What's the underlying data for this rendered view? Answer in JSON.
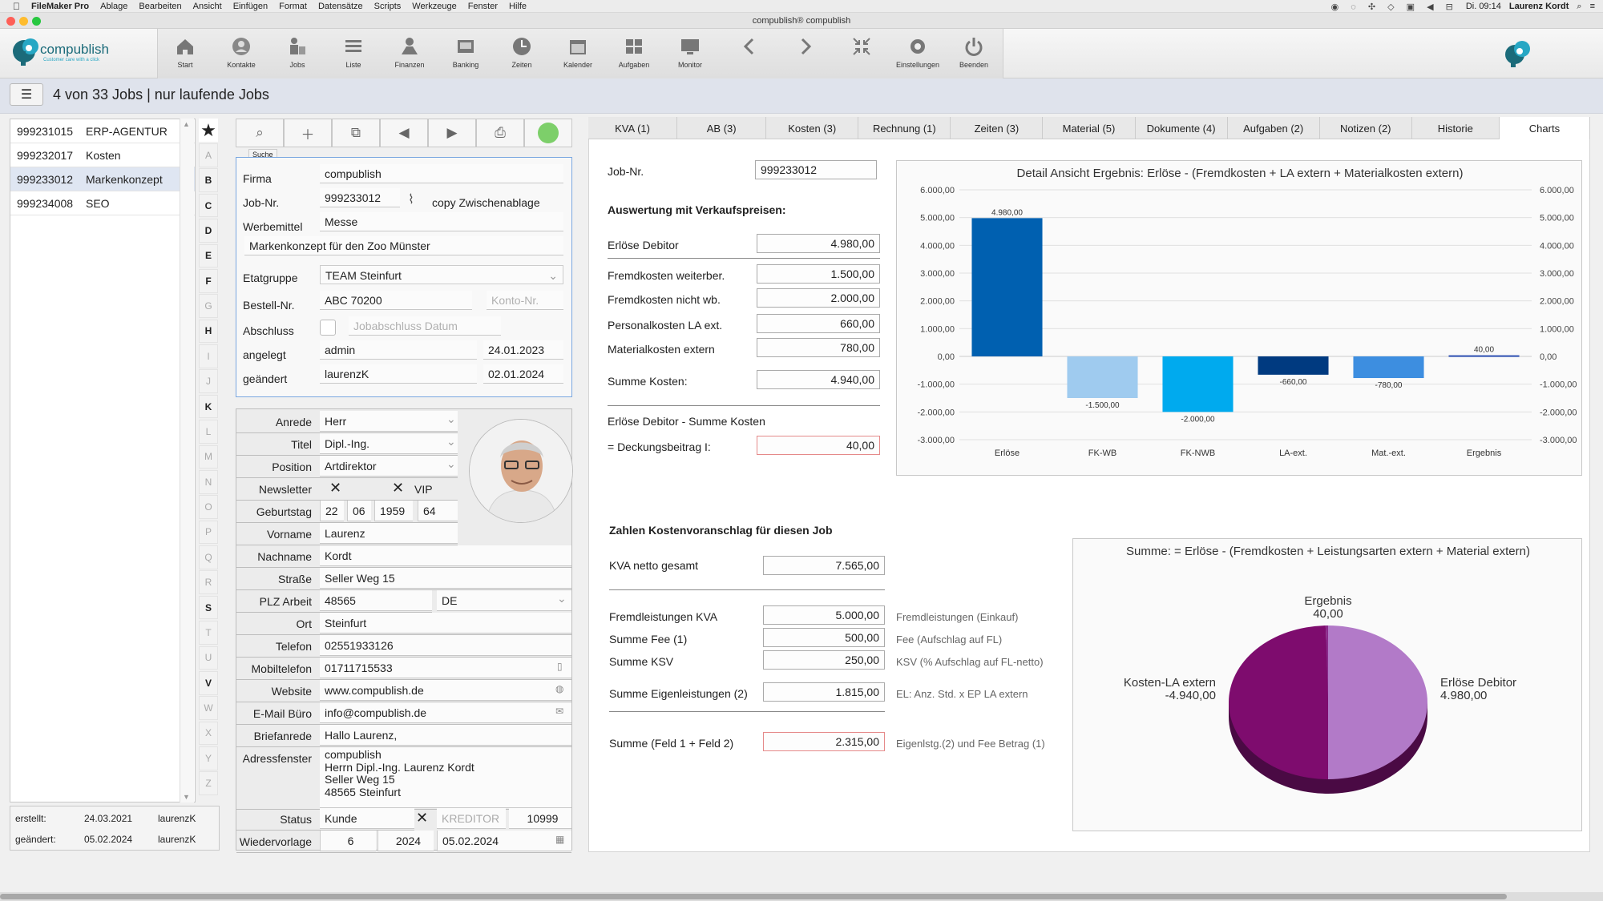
{
  "menubar": {
    "app": "FileMaker Pro",
    "items": [
      "Ablage",
      "Bearbeiten",
      "Ansicht",
      "Einfügen",
      "Format",
      "Datensätze",
      "Scripts",
      "Werkzeuge",
      "Fenster",
      "Hilfe"
    ],
    "clock": "Di. 09:14",
    "user": "Laurenz Kordt"
  },
  "window": {
    "title": "compublish® compublish"
  },
  "logo": {
    "name": "compublish",
    "tagline": "Customer care with a click"
  },
  "toolbar": {
    "buttons": [
      {
        "label": "Start",
        "icon": "home-icon"
      },
      {
        "label": "Kontakte",
        "icon": "contacts-icon"
      },
      {
        "label": "Jobs",
        "icon": "jobs-icon"
      },
      {
        "label": "Liste",
        "icon": "list-icon"
      },
      {
        "label": "Finanzen",
        "icon": "finance-icon"
      },
      {
        "label": "Banking",
        "icon": "banking-icon"
      },
      {
        "label": "Zeiten",
        "icon": "clock-icon"
      },
      {
        "label": "Kalender",
        "icon": "calendar-icon"
      },
      {
        "label": "Aufgaben",
        "icon": "tasks-icon"
      },
      {
        "label": "Monitor",
        "icon": "monitor-icon"
      },
      {
        "label": "",
        "icon": "back-icon"
      },
      {
        "label": "",
        "icon": "forward-icon"
      },
      {
        "label": "",
        "icon": "collapse-icon"
      },
      {
        "label": "Einstellungen",
        "icon": "gear-icon"
      },
      {
        "label": "Beenden",
        "icon": "power-icon"
      }
    ]
  },
  "header": {
    "title": "4 von 33 Jobs | nur laufende Jobs"
  },
  "joblist": {
    "items": [
      {
        "num": "999231015",
        "name": "ERP-AGENTUR"
      },
      {
        "num": "999232017",
        "name": "Kosten"
      },
      {
        "num": "999233012",
        "name": "Markenkonzept"
      },
      {
        "num": "999234008",
        "name": "SEO"
      }
    ],
    "footer": {
      "created_label": "erstellt:",
      "created_date": "24.03.2021",
      "created_user": "laurenzK",
      "changed_label": "geändert:",
      "changed_date": "05.02.2024",
      "changed_user": "laurenzK"
    }
  },
  "alphabet": [
    "A",
    "B",
    "C",
    "D",
    "E",
    "F",
    "G",
    "H",
    "I",
    "J",
    "K",
    "L",
    "M",
    "N",
    "O",
    "P",
    "Q",
    "R",
    "S",
    "T",
    "U",
    "V",
    "W",
    "X",
    "Y",
    "Z"
  ],
  "alphabet_active": [
    "B",
    "C",
    "D",
    "E",
    "F",
    "H",
    "K",
    "S",
    "V"
  ],
  "record_toolbar": {
    "tooltip": "Suche"
  },
  "job": {
    "firma_label": "Firma",
    "firma": "compublish",
    "jobnr_label": "Job-Nr.",
    "jobnr": "999233012",
    "copy": "copy Zwischenablage",
    "werbemittel_label": "Werbemittel",
    "werbemittel": "Messe",
    "beschreibung": "Markenkonzept für den Zoo Münster",
    "etatgruppe_label": "Etatgruppe",
    "etatgruppe": "TEAM Steinfurt",
    "bestellnr_label": "Bestell-Nr.",
    "bestellnr": "ABC 70200",
    "kontonr_ph": "Konto-Nr.",
    "abschluss_label": "Abschluss",
    "abschluss_ph": "Jobabschluss Datum",
    "angelegt_label": "angelegt",
    "angelegt_user": "admin",
    "angelegt_date": "24.01.2023",
    "geaendert_label": "geändert",
    "geaendert_user": "laurenzK",
    "geaendert_date": "02.01.2024"
  },
  "contact": {
    "anrede_label": "Anrede",
    "anrede": "Herr",
    "titel_label": "Titel",
    "titel": "Dipl.-Ing.",
    "position_label": "Position",
    "position": "Artdirektor",
    "newsletter_label": "Newsletter",
    "vip_label": "VIP",
    "geburtstag_label": "Geburtstag",
    "geb_tag": "22",
    "geb_monat": "06",
    "geb_jahr": "1959",
    "alter": "64",
    "vorname_label": "Vorname",
    "vorname": "Laurenz",
    "nachname_label": "Nachname",
    "nachname": "Kordt",
    "strasse_label": "Straße",
    "strasse": "Seller Weg 15",
    "plz_label": "PLZ Arbeit",
    "plz": "48565",
    "land": "DE",
    "ort_label": "Ort",
    "ort": "Steinfurt",
    "telefon_label": "Telefon",
    "telefon": "02551933126",
    "mobil_label": "Mobiltelefon",
    "mobil": "01711715533",
    "website_label": "Website",
    "website": "www.compublish.de",
    "email_label": "E-Mail Büro",
    "email": "info@compublish.de",
    "briefanrede_label": "Briefanrede",
    "briefanrede": "Hallo Laurenz,",
    "adressfenster_label": "Adressfenster",
    "adresse": [
      "compublish",
      "Herrn Dipl.-Ing. Laurenz  Kordt",
      "Seller Weg 15",
      "48565 Steinfurt"
    ],
    "status_label": "Status",
    "status": "Kunde",
    "kreditor": "KREDITOR",
    "kreditor_nr": "10999",
    "wiedervorlage_label": "Wiedervorlage",
    "wv_1": "6",
    "wv_2": "2024",
    "wv_date": "05.02.2024"
  },
  "tabs": [
    "KVA (1)",
    "AB (3)",
    "Kosten (3)",
    "Rechnung (1)",
    "Zeiten (3)",
    "Material (5)",
    "Dokumente (4)",
    "Aufgaben (2)",
    "Notizen (2)",
    "Historie",
    "Charts"
  ],
  "tab_active": "Charts",
  "kosten": {
    "jobnr_label": "Job-Nr.",
    "jobnr": "999233012",
    "head1": "Auswertung mit Verkaufspreisen:",
    "rows": [
      {
        "label": "Erlöse Debitor",
        "value": "4.980,00"
      },
      {
        "label": "Fremdkosten weiterber.",
        "value": "1.500,00"
      },
      {
        "label": "Fremdkosten nicht wb.",
        "value": "2.000,00"
      },
      {
        "label": "Personalkosten LA ext.",
        "value": "660,00"
      },
      {
        "label": "Materialkosten extern",
        "value": "780,00"
      },
      {
        "label": "Summe Kosten:",
        "value": "4.940,00"
      }
    ],
    "db_head": "Erlöse Debitor - Summe Kosten",
    "db_label": "= Deckungsbeitrag I:",
    "db_value": "40,00",
    "head2": "Zahlen Kostenvoranschlag für diesen Job",
    "kva_label": "KVA netto gesamt",
    "kva_value": "7.565,00",
    "rows2": [
      {
        "label": "Fremdleistungen KVA",
        "value": "5.000,00",
        "note": "Fremdleistungen (Einkauf)"
      },
      {
        "label": "Summe Fee (1)",
        "value": "500,00",
        "note": "Fee (Aufschlag auf FL)"
      },
      {
        "label": "Summe KSV",
        "value": "250,00",
        "note": "KSV (% Aufschlag auf FL-netto)"
      },
      {
        "label": "Summe Eigenleistungen (2)",
        "value": "1.815,00",
        "note": "EL: Anz. Std. x EP LA extern"
      },
      {
        "label": "Summe (Feld 1 + Feld 2)",
        "value": "2.315,00",
        "note": "Eigenlstg.(2) und Fee Betrag (1)"
      }
    ]
  },
  "chart_data": [
    {
      "type": "bar",
      "title": "Detail Ansicht Ergebnis: Erlöse - (Fremdkosten + LA extern + Materialkosten extern)",
      "categories": [
        "Erlöse",
        "FK-WB",
        "FK-NWB",
        "LA-ext.",
        "Mat.-ext.",
        "Ergebnis"
      ],
      "values": [
        4980,
        -1500,
        -2000,
        -660,
        -780,
        40
      ],
      "data_labels": [
        "4.980,00",
        "-1.500,00",
        "-2.000,00",
        "-660,00",
        "-780,00",
        "40,00"
      ],
      "colors": [
        "#0060b0",
        "#9fcbef",
        "#00aaee",
        "#003a80",
        "#3d8ee0",
        "#2a4cb0"
      ],
      "ylim": [
        -3000,
        6000
      ],
      "yticks": [
        "6.000,00",
        "5.000,00",
        "4.000,00",
        "3.000,00",
        "2.000,00",
        "1.000,00",
        "0,00",
        "-1.000,00",
        "-2.000,00",
        "-3.000,00"
      ],
      "grid": true
    },
    {
      "type": "pie",
      "title": "Summe: = Erlöse - (Fremdkosten + Leistungsarten extern + Material extern)",
      "slices": [
        {
          "label": "Erlöse Debitor",
          "value": 4980,
          "text": "4.980,00",
          "color": "#b27ac8"
        },
        {
          "label": "Kosten-LA extern",
          "value": 4940,
          "text": "-4.940,00",
          "color": "#7e0c6e"
        },
        {
          "label": "Ergebnis",
          "value": 40,
          "text": "40,00",
          "color": "#8b2a8b"
        }
      ]
    }
  ]
}
